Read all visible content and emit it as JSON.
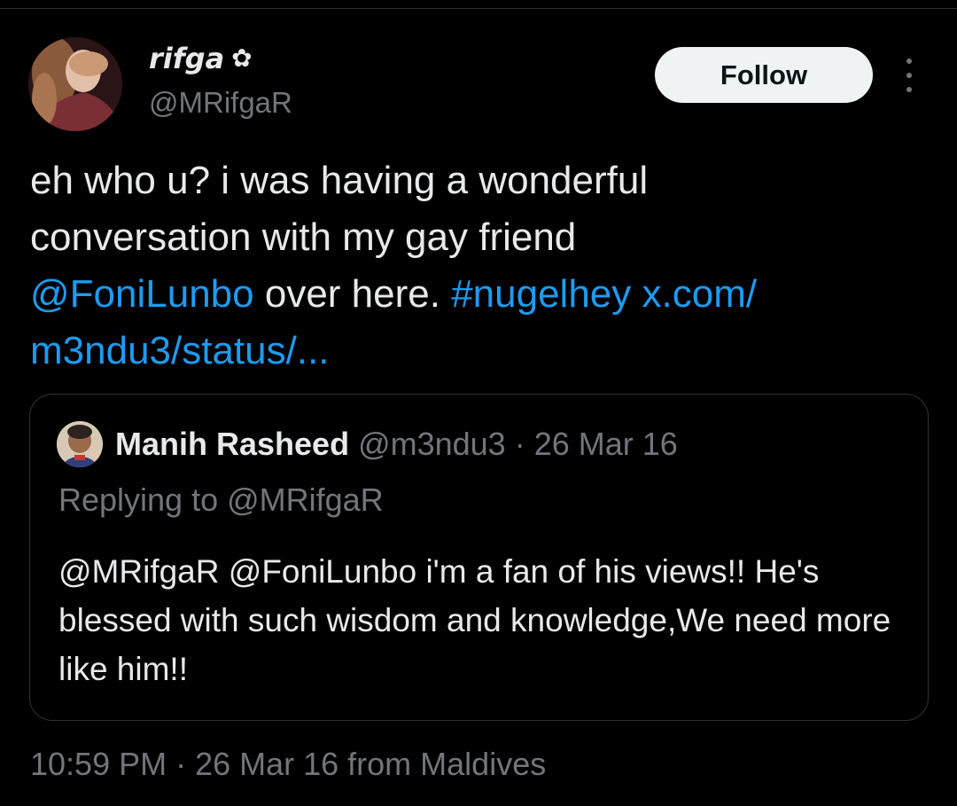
{
  "author": {
    "display_name": "rifga",
    "badge_icon": "flower-icon",
    "badge_glyph": "✿",
    "handle": "@MRifgaR"
  },
  "actions": {
    "follow_label": "Follow",
    "more_icon": "more-options-icon"
  },
  "tweet": {
    "text_part1": "eh who u? i was having a wonderful\nconversation with my gay friend\n",
    "mention": "@FoniLunbo",
    "text_part2": " over here. ",
    "hashtag": "#nugelhey",
    "text_part3": " ",
    "url": "x.com/\nm3ndu3/status/..."
  },
  "quote": {
    "display_name": "Manih Rasheed",
    "handle_and_date": " @m3ndu3 · 26 Mar 16",
    "replying_to": "Replying to @MRifgaR",
    "text": "@MRifgaR @FoniLunbo i'm a fan of his views!! He's blessed with such wisdom and knowledge,We need more like him!!"
  },
  "footer": {
    "timestamp": "10:59 PM · 26 Mar 16 from Maldives"
  },
  "colors": {
    "background": "#000000",
    "link": "#1d9bf0",
    "text": "#e7e9ea",
    "muted": "#71767b",
    "border": "#2f3336"
  }
}
